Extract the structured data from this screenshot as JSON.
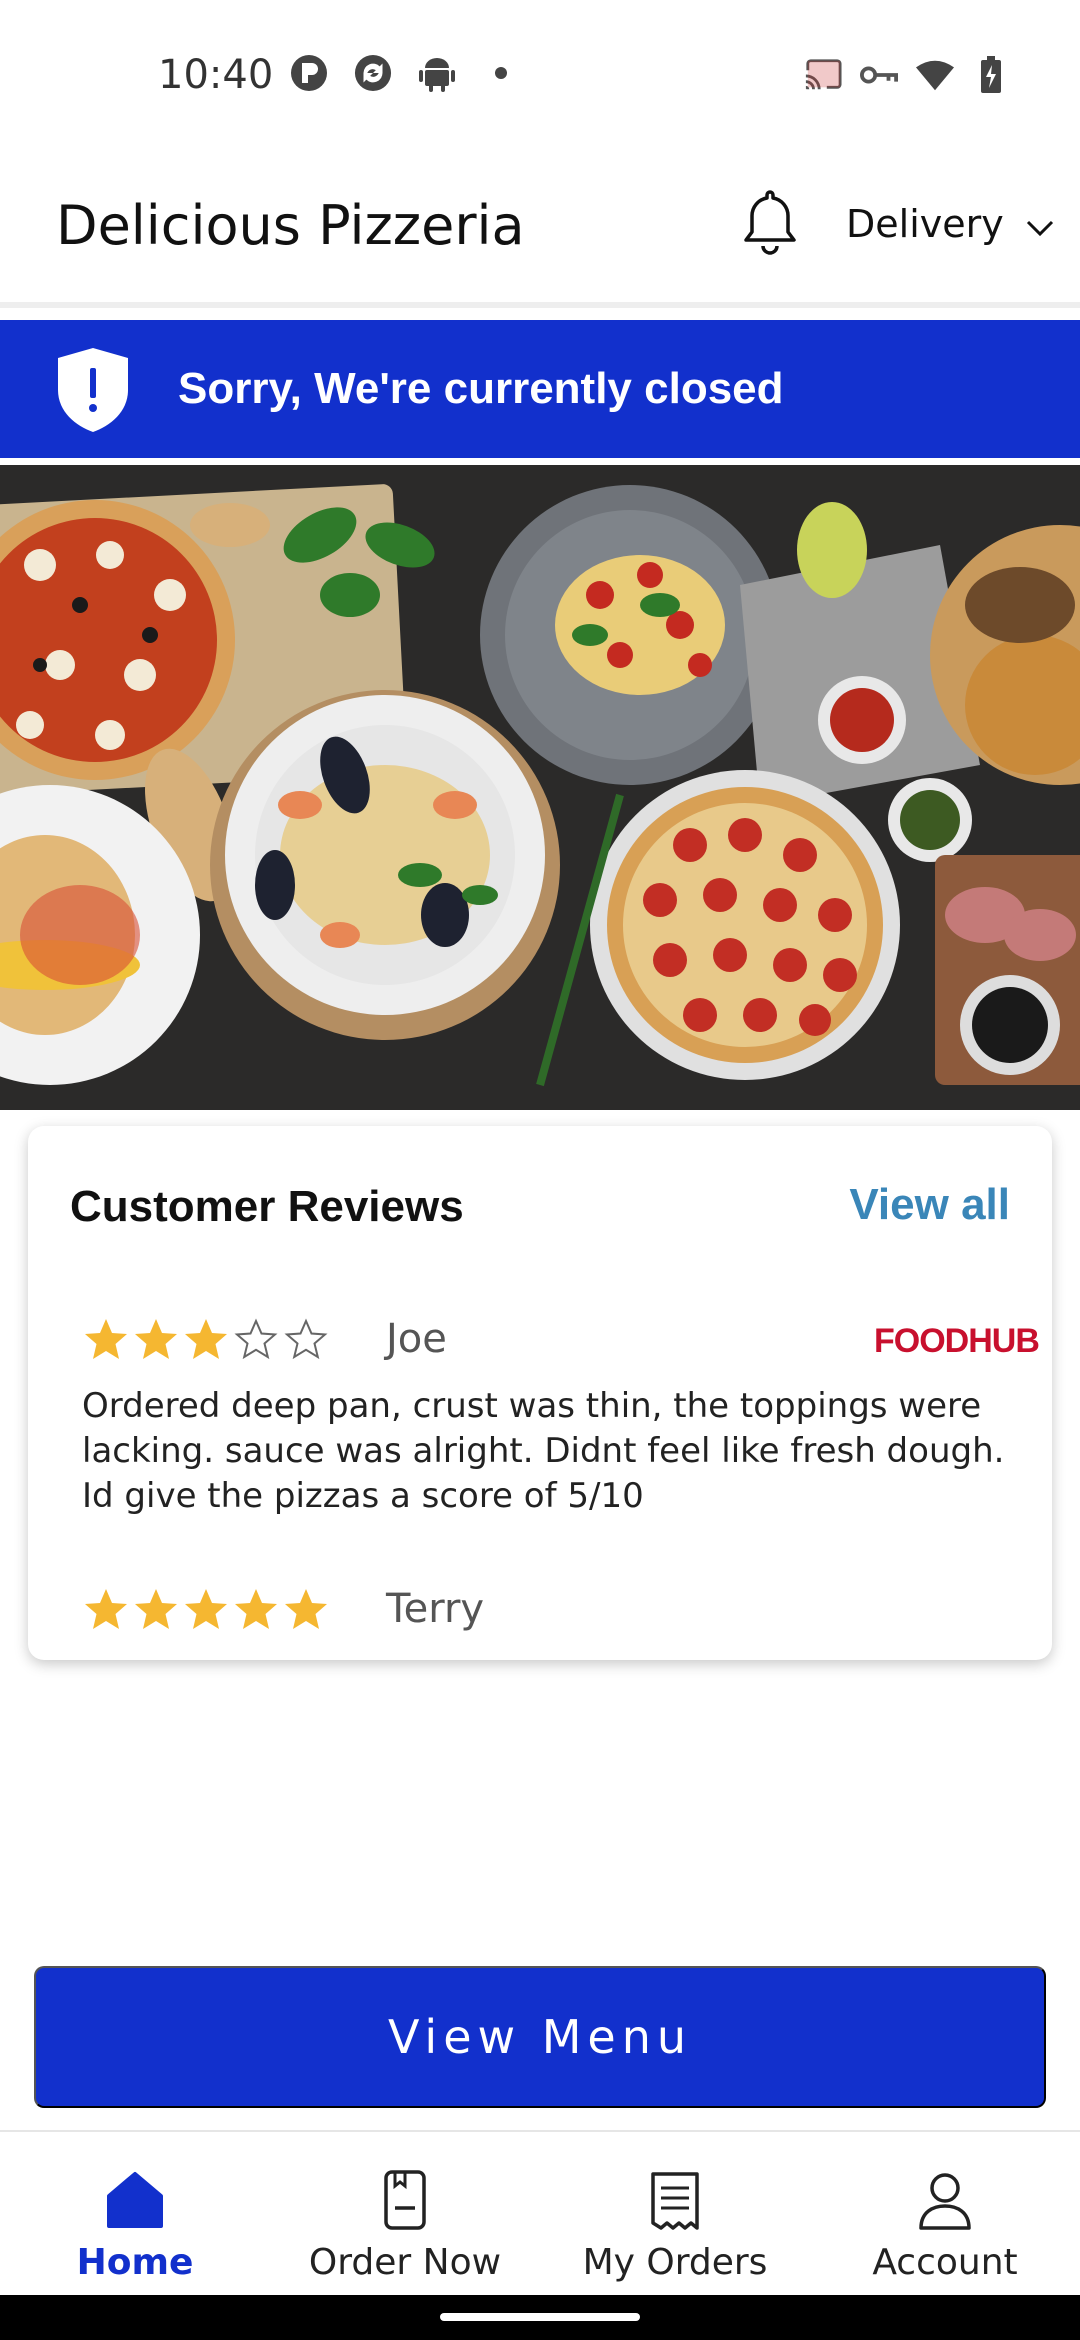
{
  "status_bar": {
    "time": "10:40",
    "left_icons": [
      "notification-p-icon",
      "sync-icon",
      "android-icon",
      "dot-icon"
    ],
    "right_icons": [
      "cast-icon",
      "vpn-key-icon",
      "wifi-icon",
      "battery-charging-icon"
    ]
  },
  "header": {
    "title": "Delicious Pizzeria",
    "bell_icon": "bell-icon",
    "order_type": "Delivery"
  },
  "banner": {
    "text": "Sorry, We're currently closed",
    "icon": "shield-alert-icon",
    "color": "#1230cc"
  },
  "hero": {
    "icon": "food-spread-photo"
  },
  "reviews": {
    "title": "Customer Reviews",
    "view_all": "View all",
    "items": [
      {
        "rating": 3,
        "max_rating": 5,
        "name": "Joe",
        "source": "FOODHUB",
        "text": "Ordered deep pan, crust was thin, the toppings were lacking. sauce was alright. Didnt feel like fresh dough. Id give the pizzas a score of 5/10"
      },
      {
        "rating": 5,
        "max_rating": 5,
        "name": "Terry",
        "source": "",
        "text": ""
      }
    ]
  },
  "cta": {
    "label": "View Menu"
  },
  "nav": {
    "items": [
      {
        "label": "Home",
        "icon": "home-icon",
        "active": true
      },
      {
        "label": "Order Now",
        "icon": "menu-book-icon",
        "active": false
      },
      {
        "label": "My Orders",
        "icon": "receipt-icon",
        "active": false
      },
      {
        "label": "Account",
        "icon": "person-icon",
        "active": false
      }
    ]
  },
  "colors": {
    "primary": "#1230cc",
    "link": "#3a86b8",
    "star": "#f5b731",
    "foodhub": "#c8102e"
  }
}
